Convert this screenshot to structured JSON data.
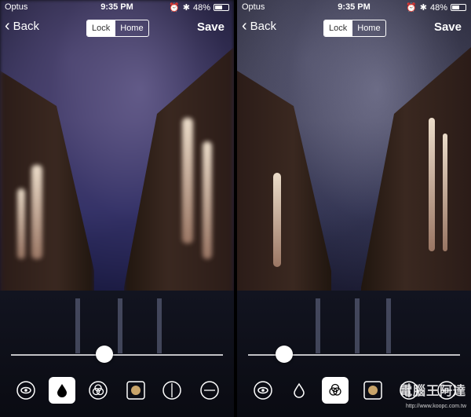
{
  "screens": [
    {
      "status": {
        "carrier": "Optus",
        "time": "9:35 PM",
        "battery": "48%"
      },
      "nav": {
        "back_label": "Back",
        "lock_label": "Lock",
        "home_label": "Home",
        "save_label": "Save"
      },
      "slider_value": 0.44,
      "active_tool": "blur-tool"
    },
    {
      "status": {
        "carrier": "Optus",
        "time": "9:35 PM",
        "battery": "48%"
      },
      "nav": {
        "back_label": "Back",
        "lock_label": "Lock",
        "home_label": "Home",
        "save_label": "Save"
      },
      "slider_value": 0.17,
      "active_tool": "color-filter-tool"
    }
  ],
  "toolbar_icons": [
    "eye-icon",
    "drop-icon",
    "color-circles-icon",
    "sticker-icon",
    "vignette-icon",
    "more-icon"
  ],
  "watermark": {
    "text": "電腦王阿達",
    "url": "http://www.koopc.com.tw"
  },
  "colors": {
    "accent": "#ffffff",
    "background": "#000000",
    "track": "#ffffff"
  }
}
